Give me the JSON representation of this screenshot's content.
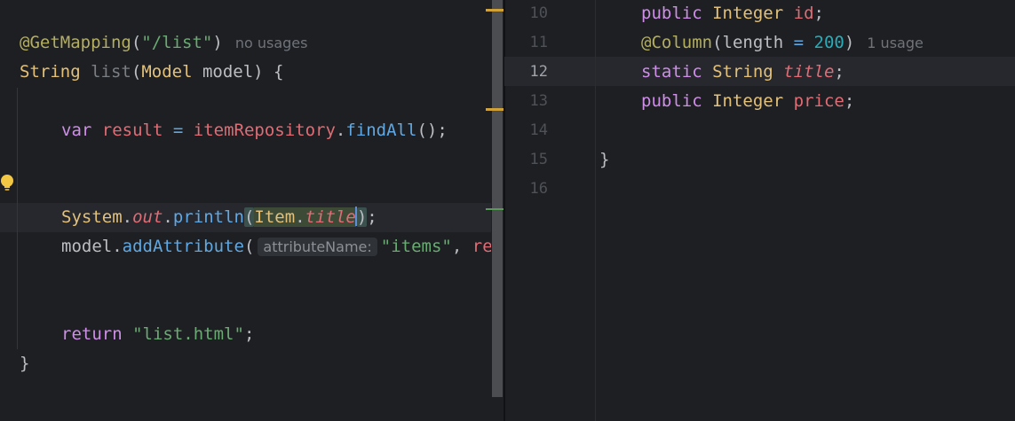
{
  "left_editor": {
    "lines": {
      "l1": {
        "annotation": "@GetMapping",
        "paren_open": "(",
        "string": "\"/list\"",
        "paren_close": ")",
        "hint": "no usages"
      },
      "l2": {
        "type": "String",
        "name": "list",
        "paren_open": "(",
        "param_type": "Model",
        "param_name": "model",
        "rest": ") {"
      },
      "l3": {
        "kw": "var",
        "var": "result",
        "eq": " = ",
        "obj": "itemRepository",
        "dot": ".",
        "fn": "findAll",
        "rest": "();"
      },
      "l4": {
        "obj": "System",
        "dot1": ".",
        "field": "out",
        "dot2": ".",
        "fn": "println",
        "paren_open": "(",
        "cls": "Item",
        "dot3": ".",
        "member": "title",
        "paren_close": ")",
        "semi": ";"
      },
      "l5": {
        "obj": "model",
        "dot": ".",
        "fn": "addAttribute",
        "paren_open": "(",
        "param_hint": "attributeName:",
        "string": "\"items\"",
        "comma": ", ",
        "overflow": "re"
      },
      "l6": {
        "kw": "return",
        "string": "\"list.html\"",
        "semi": ";"
      },
      "l7": {
        "brace": "}"
      }
    }
  },
  "right_editor": {
    "current_line": "12",
    "line_numbers": [
      "10",
      "11",
      "12",
      "13",
      "14",
      "15",
      "16"
    ],
    "lines": {
      "r10": {
        "kw": "public",
        "type": "Integer",
        "name": "id",
        "semi": ";"
      },
      "r11": {
        "annotation": "@Column",
        "paren_open": "(",
        "param": "length",
        "eq": " = ",
        "num": "200",
        "paren_close": ")",
        "hint": "1 usage"
      },
      "r12": {
        "kw": "static",
        "type": "String",
        "name": "title",
        "semi": ";"
      },
      "r13": {
        "kw": "public",
        "type": "Integer",
        "name": "price",
        "semi": ";"
      },
      "r15": {
        "brace": "}"
      }
    }
  },
  "colors": {
    "background": "#1e1f22",
    "keyword": "#cf8ee8",
    "string": "#6aab73",
    "type": "#e3c17a",
    "function": "#5fa8e3",
    "field": "#e06c75",
    "number": "#2aacb8",
    "annotation": "#b3ae60"
  },
  "icons": {
    "intention_bulb": "lightbulb-icon"
  }
}
